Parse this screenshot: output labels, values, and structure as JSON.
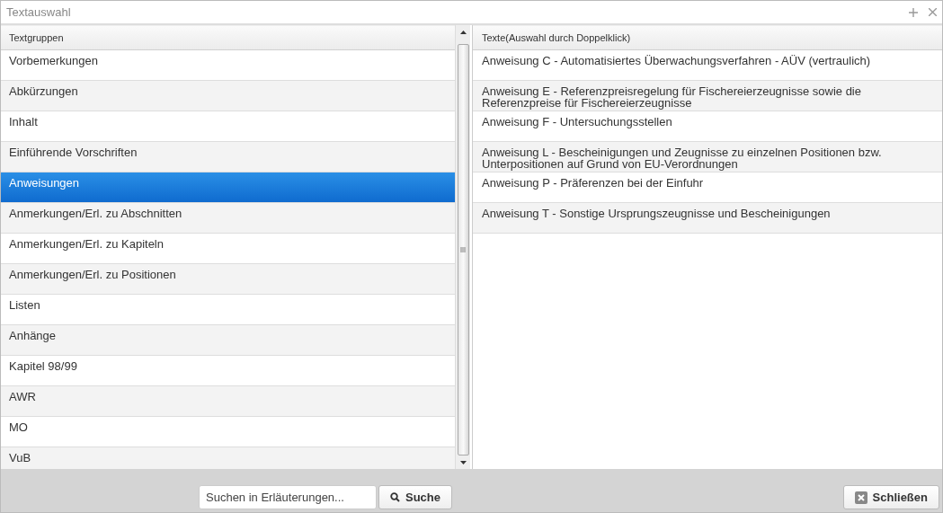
{
  "window": {
    "title": "Textauswahl"
  },
  "groups": {
    "header": "Textgruppen",
    "items": [
      {
        "label": "Vorbemerkungen",
        "selected": false
      },
      {
        "label": "Abkürzungen",
        "selected": false
      },
      {
        "label": "Inhalt",
        "selected": false
      },
      {
        "label": "Einführende Vorschriften",
        "selected": false
      },
      {
        "label": "Anweisungen",
        "selected": true
      },
      {
        "label": "Anmerkungen/Erl. zu Abschnitten",
        "selected": false
      },
      {
        "label": "Anmerkungen/Erl. zu Kapiteln",
        "selected": false
      },
      {
        "label": "Anmerkungen/Erl. zu Positionen",
        "selected": false
      },
      {
        "label": "Listen",
        "selected": false
      },
      {
        "label": "Anhänge",
        "selected": false
      },
      {
        "label": "Kapitel 98/99",
        "selected": false
      },
      {
        "label": "AWR",
        "selected": false
      },
      {
        "label": "MO",
        "selected": false
      },
      {
        "label": "VuB",
        "selected": false
      }
    ]
  },
  "texts": {
    "header": "Texte(Auswahl durch Doppelklick)",
    "items": [
      "Anweisung C - Automatisiertes Überwachungsverfahren - AÜV (vertraulich)",
      "Anweisung E - Referenzpreisregelung für Fischereierzeugnisse sowie die Referenzpreise für Fischereierzeugnisse",
      "Anweisung F - Untersuchungsstellen",
      "Anweisung L - Bescheinigungen und Zeugnisse zu einzelnen Positionen bzw. Unterpositionen auf Grund von EU-Verordnungen",
      "Anweisung P - Präferenzen bei der Einfuhr",
      "Anweisung T - Sonstige Ursprungszeugnisse und Bescheinigungen"
    ]
  },
  "search": {
    "placeholder": "Suchen in Erläuterungen...",
    "button": "Suche"
  },
  "close_button": "Schließen"
}
